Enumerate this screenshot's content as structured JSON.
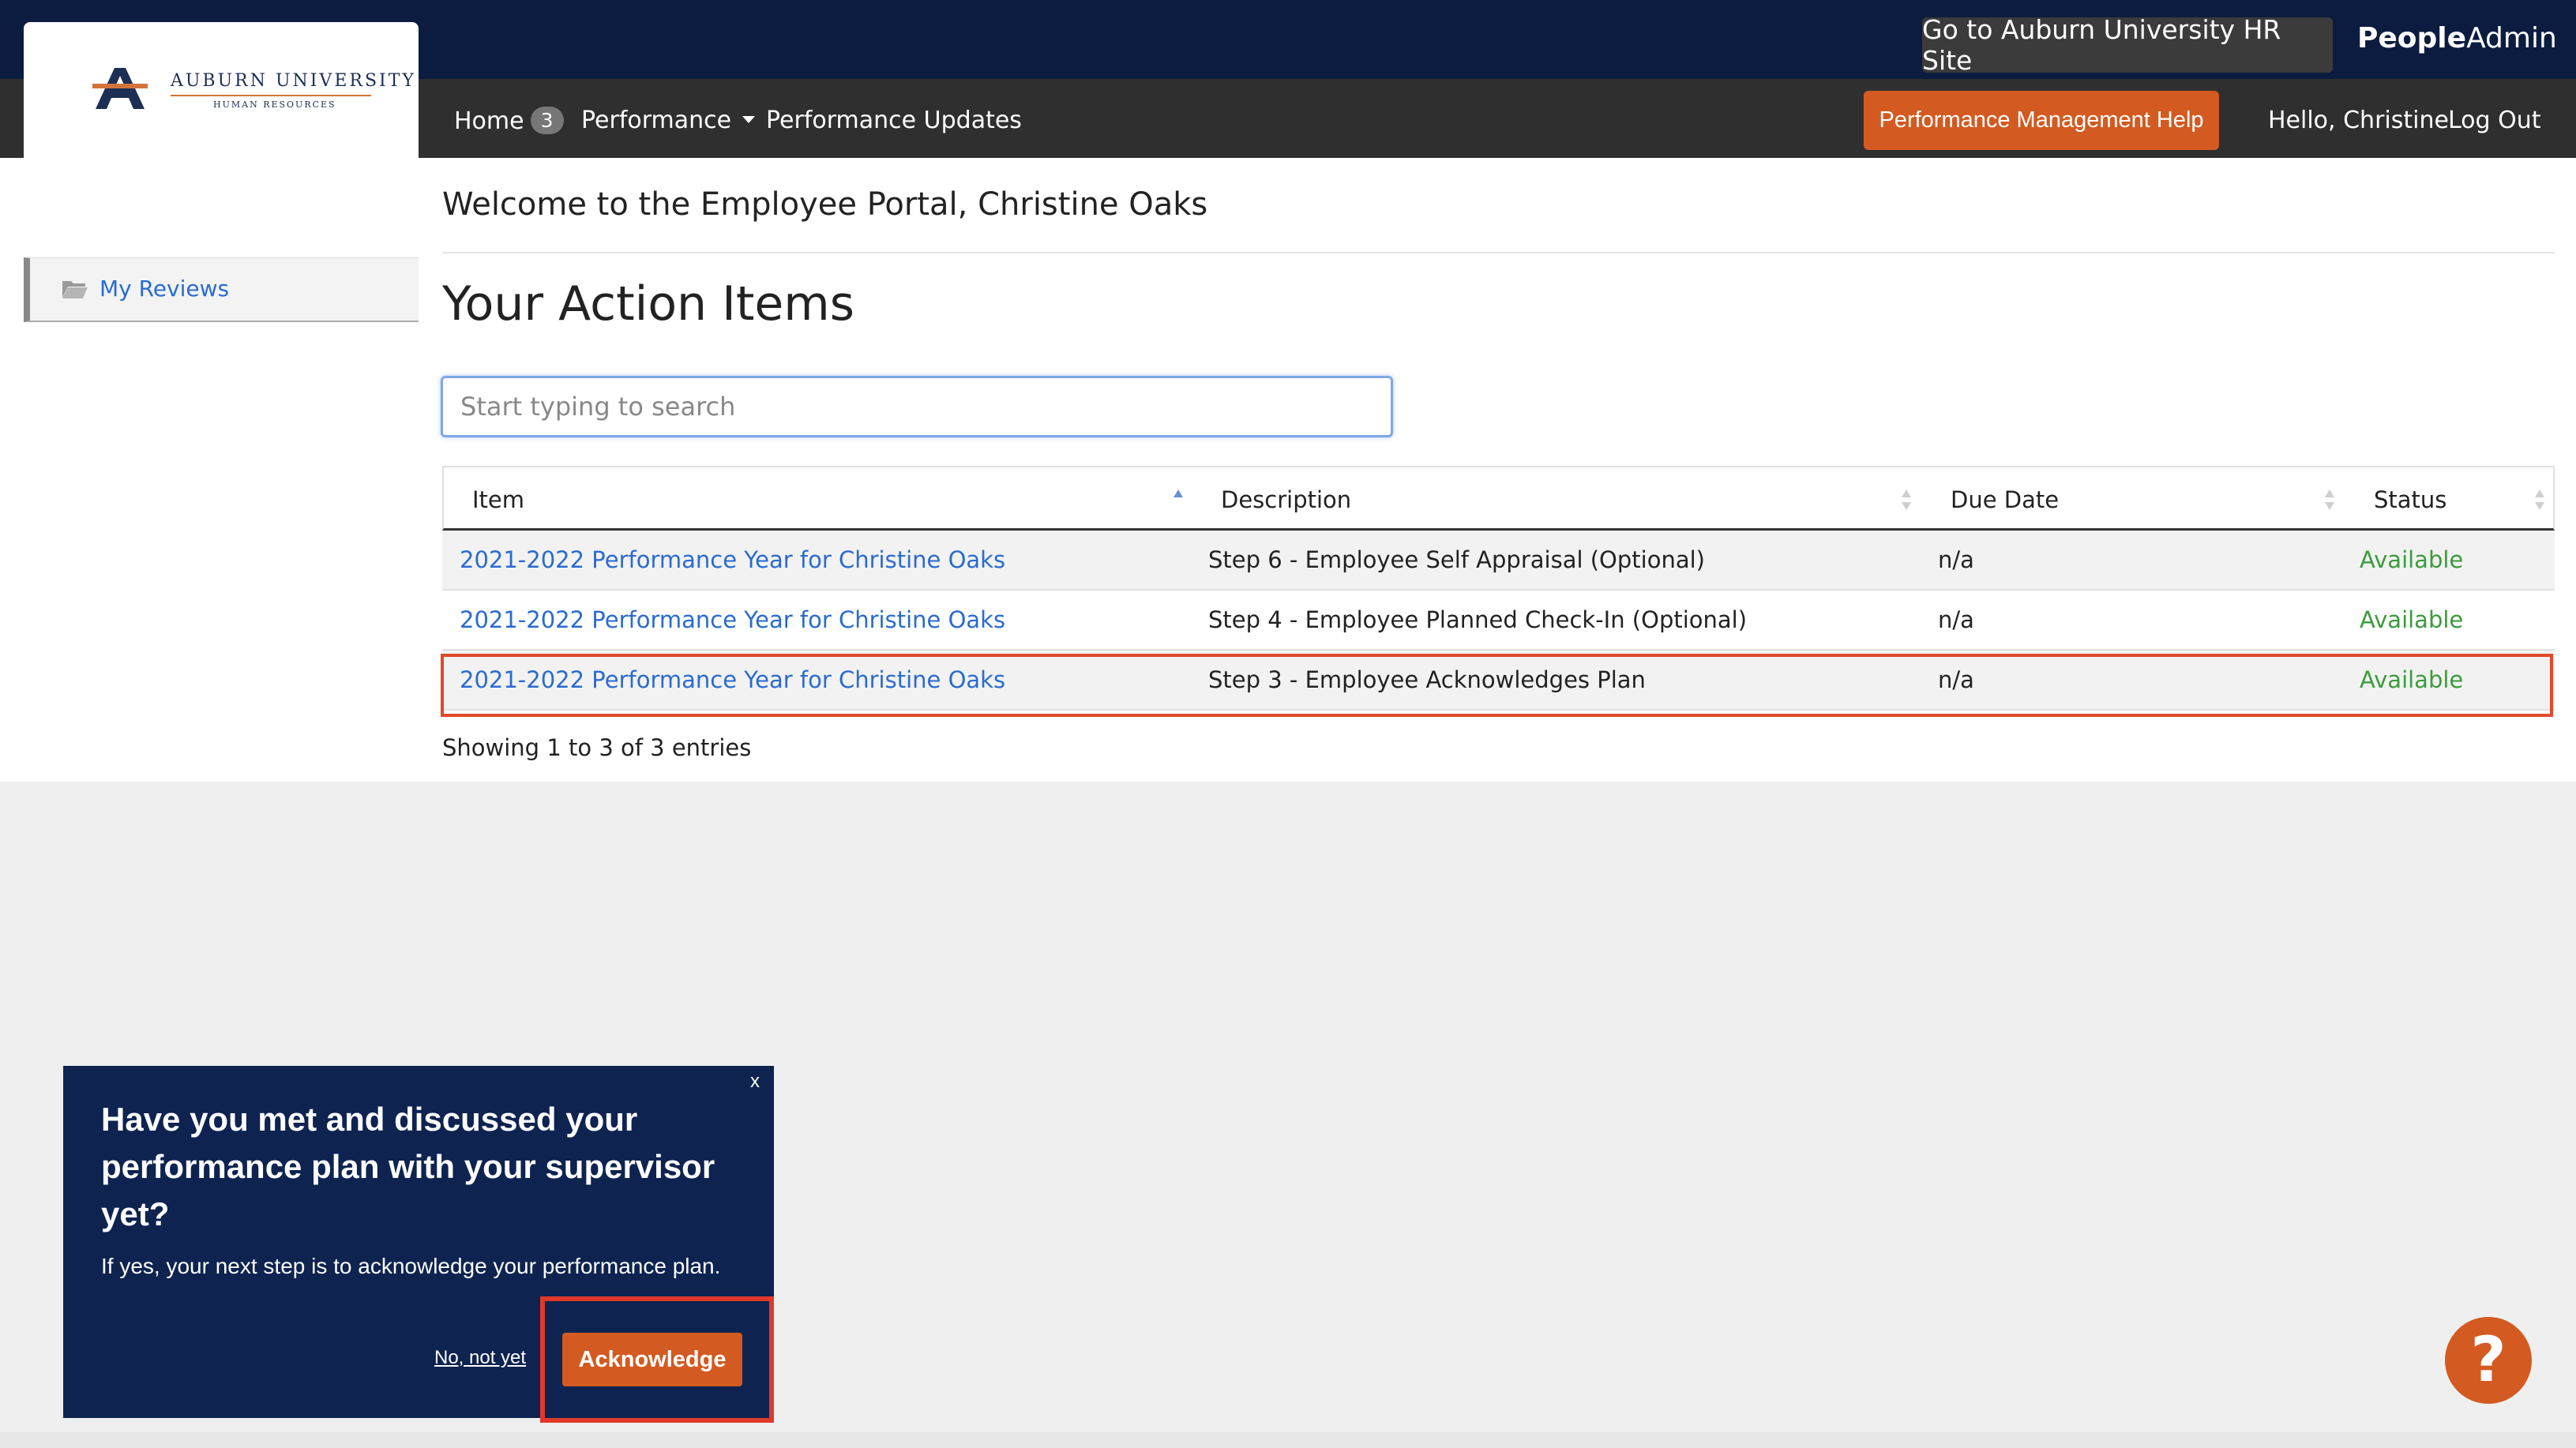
{
  "header": {
    "logo_text": "AUBURN UNIVERSITY",
    "logo_subtext": "HUMAN RESOURCES",
    "hr_site_button": "Go to Auburn University HR Site",
    "brand_bold": "People",
    "brand_regular": "Admin"
  },
  "nav": {
    "home_label": "Home",
    "home_badge": "3",
    "performance_label": "Performance",
    "performance_updates_label": "Performance Updates",
    "help_button": "Performance Management Help",
    "greeting": "Hello, Christine",
    "logout": "Log Out"
  },
  "sidebar": {
    "items": [
      {
        "label": "My Reviews",
        "icon": "folder-open-icon"
      }
    ]
  },
  "main": {
    "welcome": "Welcome to the Employee Portal, Christine Oaks",
    "section_title": "Your Action Items",
    "search": {
      "placeholder": "Start typing to search",
      "value": ""
    },
    "table": {
      "columns": [
        "Item",
        "Description",
        "Due Date",
        "Status"
      ],
      "rows": [
        {
          "item": "2021-2022 Performance Year for Christine Oaks",
          "description": "Step 6 - Employee Self Appraisal (Optional)",
          "due_date": "n/a",
          "status": "Available"
        },
        {
          "item": "2021-2022 Performance Year for Christine Oaks",
          "description": "Step 4 - Employee Planned Check-In (Optional)",
          "due_date": "n/a",
          "status": "Available"
        },
        {
          "item": "2021-2022 Performance Year for Christine Oaks",
          "description": "Step 3 - Employee Acknowledges Plan",
          "due_date": "n/a",
          "status": "Available"
        }
      ]
    },
    "showing": "Showing 1 to 3 of 3 entries"
  },
  "popup": {
    "close": "x",
    "question": "Have you met and discussed your performance plan with your supervisor yet?",
    "subtext": "If yes, your next step is to acknowledge your performance plan.",
    "no_link": "No, not yet",
    "acknowledge_button": "Acknowledge"
  },
  "help_widget": {
    "label": "?"
  },
  "colors": {
    "topbar": "#0b1c40",
    "navbar": "#2f2f2f",
    "accent_orange": "#d35a20",
    "link_blue": "#2a6bd0",
    "status_green": "#3c9b3c",
    "highlight_red": "#e0492c",
    "popup_navy": "#0e2350"
  }
}
